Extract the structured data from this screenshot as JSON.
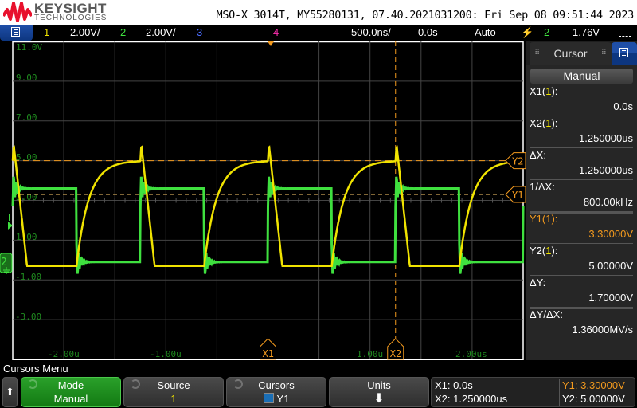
{
  "header": {
    "brand": "KEYSIGHT",
    "brand_sub": "TECHNOLOGIES",
    "model_line": "MSO-X 3014T, MY55280131, 07.40.2021031200: Fri Sep 08 09:51:44 2023"
  },
  "status_bar": {
    "ch1_num": "1",
    "ch1_scale": "2.00V/",
    "ch2_num": "2",
    "ch2_scale": "2.00V/",
    "ch3_num": "3",
    "ch4_num": "4",
    "timebase": "500.0ns/",
    "delay": "0.0s",
    "trigger_mode": "Auto",
    "trigger_source": "2",
    "trigger_level": "1.76V",
    "colors": {
      "ch1": "#f0e300",
      "ch2": "#3fe03f",
      "ch3": "#4a6cff",
      "ch4": "#ff2fb0"
    }
  },
  "graticule": {
    "y_labels": [
      "11.0V",
      "9.00",
      "7.00",
      "5.00",
      "3.00",
      "1.00",
      "-1.00",
      "-3.00"
    ],
    "x_labels": [
      "-2.00u",
      "-1.00u",
      "1.00u",
      "2.00us"
    ],
    "trigger_marker": "T",
    "ch2_ground_marker": "2"
  },
  "waveforms": {
    "time_per_div_us": 0.5,
    "volts_per_div": 2.0,
    "period_us": 1.25,
    "ch1": {
      "high_v": 5.0,
      "low_v": -0.3
    },
    "ch2": {
      "high_v": 3.6,
      "low_v": -0.1
    }
  },
  "cursors_on_screen": {
    "x1_label": "X1",
    "x2_label": "X2",
    "y1_label": "Y1",
    "y2_label": "Y2",
    "x1_time_us": 0.0,
    "x2_time_us": 1.25,
    "y1_v": 3.3,
    "y2_v": 5.0
  },
  "cursor_panel": {
    "title": "Cursor",
    "mode_button": "Manual",
    "rows": [
      {
        "label": "X1(",
        "src": "1",
        "suffix": "):",
        "value": "0.0s"
      },
      {
        "label": "X2(",
        "src": "1",
        "suffix": "):",
        "value": "1.250000us"
      },
      {
        "label": "ΔX:",
        "src": "",
        "suffix": "",
        "value": "1.250000us"
      },
      {
        "label": "1/ΔX:",
        "src": "",
        "suffix": "",
        "value": "800.00kHz"
      },
      {
        "label": "Y1(",
        "src": "1",
        "suffix": "):",
        "value": "3.30000V"
      },
      {
        "label": "Y2(",
        "src": "1",
        "suffix": "):",
        "value": "5.00000V"
      },
      {
        "label": "ΔY:",
        "src": "",
        "suffix": "",
        "value": "1.70000V"
      },
      {
        "label": "ΔY/ΔX:",
        "src": "",
        "suffix": "",
        "value": "1.36000MV/s"
      }
    ]
  },
  "softkeys": {
    "menu_title": "Cursors Menu",
    "up_arrow": "⬆",
    "mode_label": "Mode",
    "mode_value": "Manual",
    "source_label": "Source",
    "source_value": "1",
    "cursors_label": "Cursors",
    "cursors_value": "Y1",
    "units_label": "Units",
    "units_value": "⬇"
  },
  "readout": {
    "x1": "X1:  0.0s",
    "x2": "X2:  1.250000us",
    "y1": "Y1:  3.30000V",
    "y2": "Y2:  5.00000V"
  }
}
